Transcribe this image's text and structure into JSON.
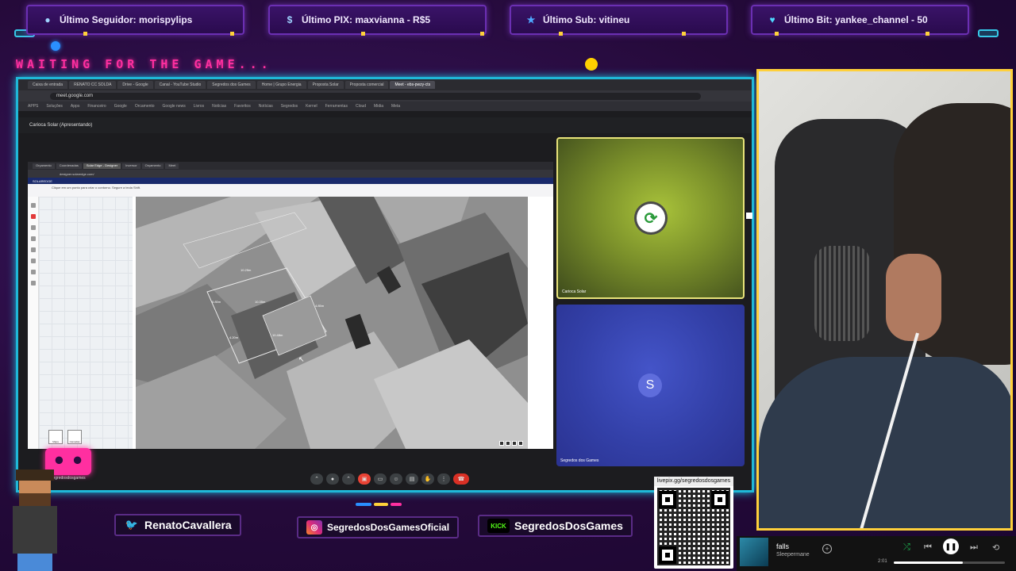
{
  "alerts": [
    {
      "label": "Último Seguidor: morispylips",
      "icon": "user-icon",
      "color": "#9fd3ff"
    },
    {
      "label": "Último PIX: maxvianna - R$5",
      "icon": "dollar-icon",
      "color": "#9fd3ff"
    },
    {
      "label": "Último Sub: vitineu",
      "icon": "star-icon",
      "color": "#4fa8ff"
    },
    {
      "label": "Último Bit: yankee_channel - 50",
      "icon": "heart-gem-icon",
      "color": "#4fd8ff"
    }
  ],
  "waiting_text": "WAITING FOR THE GAME...",
  "browser": {
    "tabs": [
      "Caixa de entrada",
      "RENATO CC SOLDA",
      "Drive - Google",
      "Canal - YouTube Studio",
      "Segredos dos Games",
      "Home | Grupo Energia",
      "Proposta Solar",
      "Proposta comercial",
      "Meet - ebs-pwzy-cts"
    ],
    "active_tab_index": 8,
    "url": "meet.google.com",
    "bookmarks": [
      "APPS",
      "Soluções",
      "Apps",
      "Financeiro",
      "Google",
      "Orcamento",
      "Google news",
      "Livros",
      "Notícias",
      "Favoritos",
      "Notícias",
      "Segredos",
      "Kernel",
      "Ferramentas",
      "Cloud",
      "Midia",
      "Meta"
    ]
  },
  "meet": {
    "presenter_title": "Carioca Solar (Apresentando)",
    "inner_tabs": [
      "Orçamento",
      "Coordenadas",
      "Solar Edge - Designer",
      "Inversor",
      "Orçamento",
      "Meet"
    ],
    "inner_active": 2,
    "inner_url": "designer.solaredge.com/",
    "app_header": "SOLAREDGE",
    "app_notice": "Clique em um ponto para criar o contorno. Segure a tecla Shift.",
    "mini_labels": [
      "Mapa",
      "Camadas"
    ],
    "measures": [
      "10.25m",
      "10.35m",
      "5.85m",
      "4.20m",
      "10.48m",
      "4.85m"
    ],
    "tile1_name": "Carioca Solar",
    "tile2_name": "Segredos dos Games",
    "tile2_initial": "S",
    "brand_color": "#e8e37a"
  },
  "socials": [
    {
      "name": "RenatoCavallera",
      "icon": "twitter-bird-icon",
      "color": "#1d9bf0"
    },
    {
      "name": "SegredosDosGamesOficial",
      "icon": "instagram-icon",
      "color": "#e1306c"
    },
    {
      "name": "SegredosDosGames",
      "icon": "kick-logo-icon",
      "color": "#53fc18",
      "icon_text": "KICK"
    }
  ],
  "qr": {
    "url": "livepix.gg/segredosdosgames"
  },
  "streamer_tag": "segredosdosgames",
  "player": {
    "track": "falls",
    "artist": "Sleepermane",
    "elapsed": "2:01",
    "progress_pct": 62
  }
}
